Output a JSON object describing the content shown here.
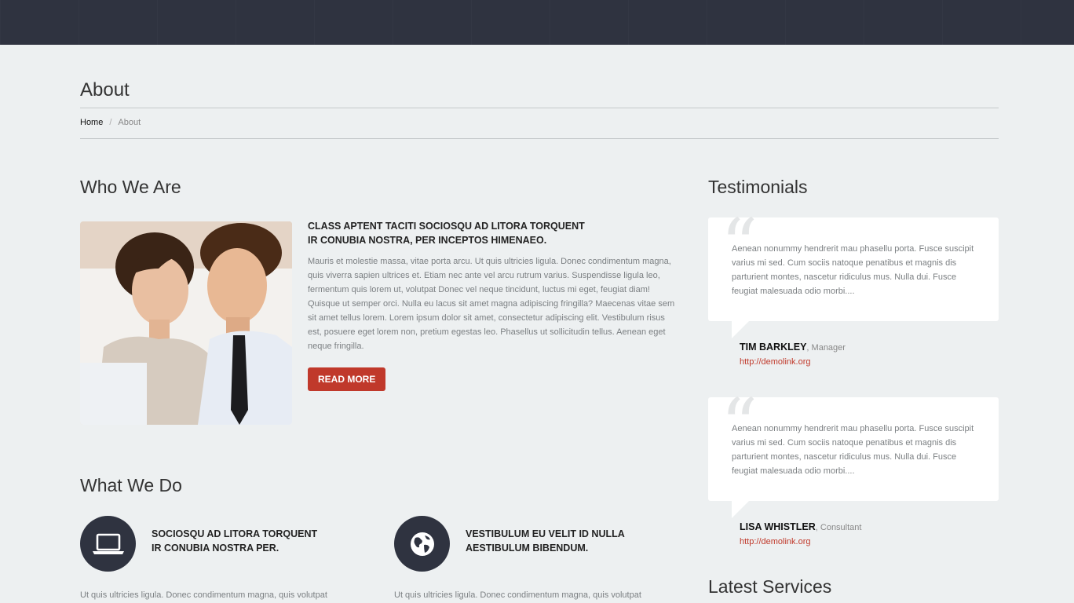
{
  "page": {
    "title": "About",
    "breadcrumb": {
      "home": "Home",
      "separator": "/",
      "current": "About"
    }
  },
  "who_we_are": {
    "heading": "Who We Are",
    "title_line1": "CLASS APTENT TACITI SOCIOSQU AD LITORA TORQUENT",
    "title_line2": "IR CONUBIA NOSTRA, PER INCEPTOS HIMENAEO.",
    "body": "Mauris et molestie massa, vitae porta arcu. Ut quis ultricies ligula. Donec condimentum magna, quis viverra sapien ultrices et. Etiam nec ante vel arcu rutrum varius. Suspendisse ligula leo, fermentum quis lorem ut, volutpat Donec vel neque tincidunt, luctus mi eget, feugiat diam! Quisque ut semper orci. Nulla eu lacus sit amet magna adipiscing fringilla? Maecenas vitae sem sit amet tellus lorem. Lorem ipsum dolor sit amet, consectetur adipiscing elit. Vestibulum risus est, posuere eget lorem non, pretium egestas leo. Phasellus ut sollicitudin tellus. Aenean eget neque fringilla.",
    "button": "READ MORE"
  },
  "what_we_do": {
    "heading": "What We Do",
    "features": [
      {
        "icon": "laptop-icon",
        "title_line1": "SOCIOSQU AD LITORA TORQUENT",
        "title_line2": "IR CONUBIA NOSTRA PER.",
        "text": "Ut quis ultricies ligula. Donec condimentum magna, quis volutpat"
      },
      {
        "icon": "globe-icon",
        "title_line1": "VESTIBULUM EU VELIT ID NULLA",
        "title_line2": "AESTIBULUM BIBENDUM.",
        "text": "Ut quis ultricies ligula. Donec condimentum magna, quis volutpat"
      }
    ]
  },
  "testimonials": {
    "heading": "Testimonials",
    "items": [
      {
        "text": "Aenean nonummy hendrerit mau phasellu porta. Fusce suscipit varius mi sed. Cum sociis natoque penatibus et magnis dis parturient montes, nascetur ridiculus mus. Nulla dui. Fusce feugiat malesuada odio morbi....",
        "name": "TIM BARKLEY",
        "role": ", Manager",
        "link": "http://demolink.org"
      },
      {
        "text": "Aenean nonummy hendrerit mau phasellu porta. Fusce suscipit varius mi sed. Cum sociis natoque penatibus et magnis dis parturient montes, nascetur ridiculus mus. Nulla dui. Fusce feugiat malesuada odio morbi....",
        "name": "LISA WHISTLER",
        "role": ", Consultant",
        "link": "http://demolink.org"
      }
    ]
  },
  "latest_services": {
    "heading": "Latest Services"
  },
  "colors": {
    "header_bg": "#2f3340",
    "page_bg": "#edf0f1",
    "accent": "#c0392b",
    "icon_circle": "#2f3340"
  }
}
